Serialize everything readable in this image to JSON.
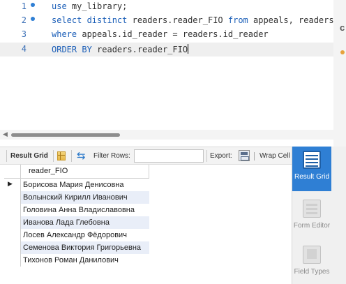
{
  "editor": {
    "lines": [
      {
        "number": "1",
        "marker": true,
        "tokens": [
          {
            "t": "use",
            "kw": true
          },
          {
            "t": " my_library;",
            "kw": false
          }
        ]
      },
      {
        "number": "2",
        "marker": true,
        "tokens": [
          {
            "t": "select distinct",
            "kw": true
          },
          {
            "t": " readers.reader_FIO ",
            "kw": false
          },
          {
            "t": "from",
            "kw": true
          },
          {
            "t": " appeals, readers",
            "kw": false
          }
        ]
      },
      {
        "number": "3",
        "marker": false,
        "tokens": [
          {
            "t": "where",
            "kw": true
          },
          {
            "t": " appeals.id_reader = readers.id_reader",
            "kw": false
          }
        ]
      },
      {
        "number": "4",
        "marker": false,
        "tokens": [
          {
            "t": "ORDER BY",
            "kw": true
          },
          {
            "t": " readers.reader_FIO",
            "kw": false
          }
        ]
      }
    ],
    "active_line": 3,
    "colors": {
      "keyword": "#1c5fb8",
      "line_number": "#3b6fb6",
      "marker": "#2f7fd4"
    }
  },
  "right_strip": {
    "letter": "c"
  },
  "toolbar": {
    "result_grid_label": "Result Grid",
    "filter_rows_label": "Filter Rows:",
    "filter_value": "",
    "export_label": "Export:",
    "wrap_label": "Wrap Cell Content:",
    "icons": [
      "grid-icon",
      "refresh-icon",
      "export-icon",
      "wrap-icon"
    ]
  },
  "result": {
    "column": "reader_FIO",
    "rows": [
      "Борисова Мария Денисовна",
      "Волынский Кирилл Иванович",
      "Головина Анна Владиславовна",
      "Иванова Лада Глебовна",
      "Лосев Александр Фёдорович",
      "Семенова Виктория Григорьевна",
      "Тихонов Роман Данилович"
    ],
    "current_row": 0
  },
  "side_panel": {
    "buttons": [
      {
        "label": "Result Grid",
        "icon": "result-grid-icon",
        "active": true
      },
      {
        "label": "Form Editor",
        "icon": "form-editor-icon",
        "active": false
      },
      {
        "label": "Field Types",
        "icon": "field-types-icon",
        "active": false
      }
    ],
    "accent": "#2f7fd4"
  }
}
